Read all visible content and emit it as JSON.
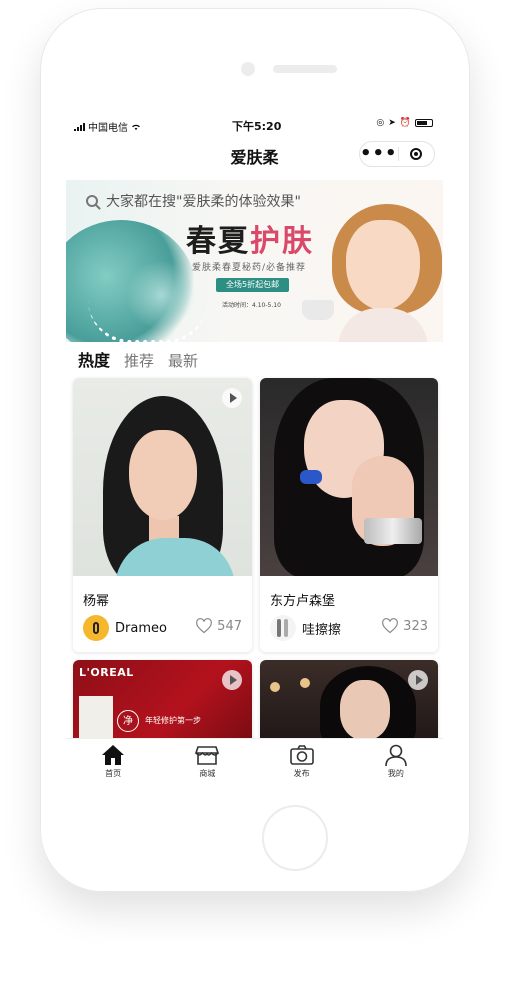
{
  "status_bar": {
    "carrier": "中国电信",
    "time": "下午5:20"
  },
  "nav": {
    "title": "爱肤柔"
  },
  "search": {
    "placeholder": "大家都在搜\"爱肤柔的体验效果\""
  },
  "banner": {
    "headline_a": "春夏",
    "headline_b": "护",
    "headline_c": "肤",
    "subtitle": "爱肤柔春夏秘药/必备推荐",
    "ribbon": "全场5折起包邮",
    "date": "活动时间：4.10-5.10"
  },
  "tabs": [
    {
      "label": "热度",
      "active": true
    },
    {
      "label": "推荐",
      "active": false
    },
    {
      "label": "最新",
      "active": false
    }
  ],
  "posts": [
    {
      "title": "杨幂",
      "author": "Drameo",
      "likes": "547"
    },
    {
      "title": "东方卢森堡",
      "author": "哇擦擦",
      "likes": "323"
    },
    {
      "brand": "L'OREAL",
      "circle_char": "净",
      "slogan": "年轻修护第一步"
    },
    {}
  ],
  "tabbar": [
    {
      "label": "首页",
      "icon": "home-icon",
      "active": true
    },
    {
      "label": "商城",
      "icon": "shop-icon",
      "active": false
    },
    {
      "label": "发布",
      "icon": "camera-icon",
      "active": false
    },
    {
      "label": "我的",
      "icon": "person-icon",
      "active": false
    }
  ],
  "colors": {
    "ribbon": "#2d8f84",
    "accent": "#d94a6a",
    "avatar_yellow": "#f5b72c"
  }
}
